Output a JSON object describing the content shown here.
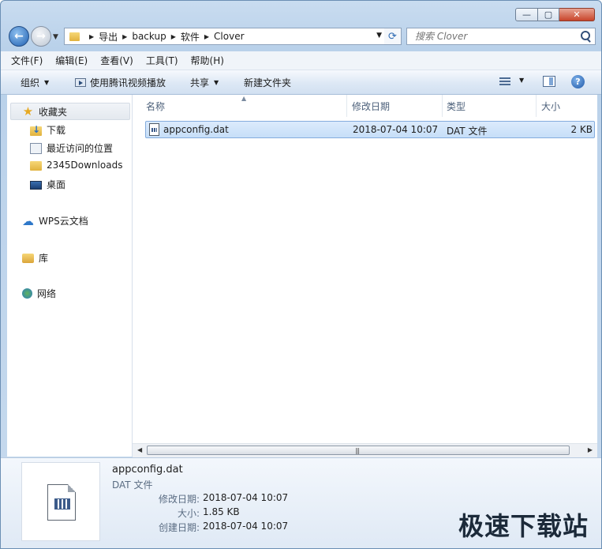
{
  "window": {
    "caption_min": "—",
    "caption_max": "▢",
    "caption_close": "✕"
  },
  "address": {
    "crumbs": [
      "导出",
      "backup",
      "软件",
      "Clover"
    ]
  },
  "search": {
    "placeholder": "搜索 Clover"
  },
  "menu": [
    "文件(F)",
    "编辑(E)",
    "查看(V)",
    "工具(T)",
    "帮助(H)"
  ],
  "toolbar": {
    "organize": "组织",
    "play_with": "使用腾讯视频播放",
    "share": "共享",
    "new_folder": "新建文件夹"
  },
  "nav": {
    "favorites": "收藏夹",
    "favorites_items": [
      "下载",
      "最近访问的位置",
      "2345Downloads",
      "桌面"
    ],
    "wps": "WPS云文档",
    "libraries": "库",
    "network": "网络"
  },
  "columns": {
    "name": "名称",
    "modified": "修改日期",
    "type": "类型",
    "size": "大小"
  },
  "files": [
    {
      "name": "appconfig.dat",
      "modified": "2018-07-04 10:07",
      "type": "DAT 文件",
      "size": "2 KB"
    }
  ],
  "details": {
    "name": "appconfig.dat",
    "type": "DAT 文件",
    "modified_label": "修改日期:",
    "modified_value": "2018-07-04 10:07",
    "size_label": "大小:",
    "size_value": "1.85 KB",
    "created_label": "创建日期:",
    "created_value": "2018-07-04 10:07"
  },
  "watermark": "极速下载站",
  "icons": {
    "back": "back-arrow-icon",
    "forward": "forward-arrow-icon",
    "refresh": "refresh-icon",
    "search": "search-icon",
    "help": "help-icon"
  }
}
